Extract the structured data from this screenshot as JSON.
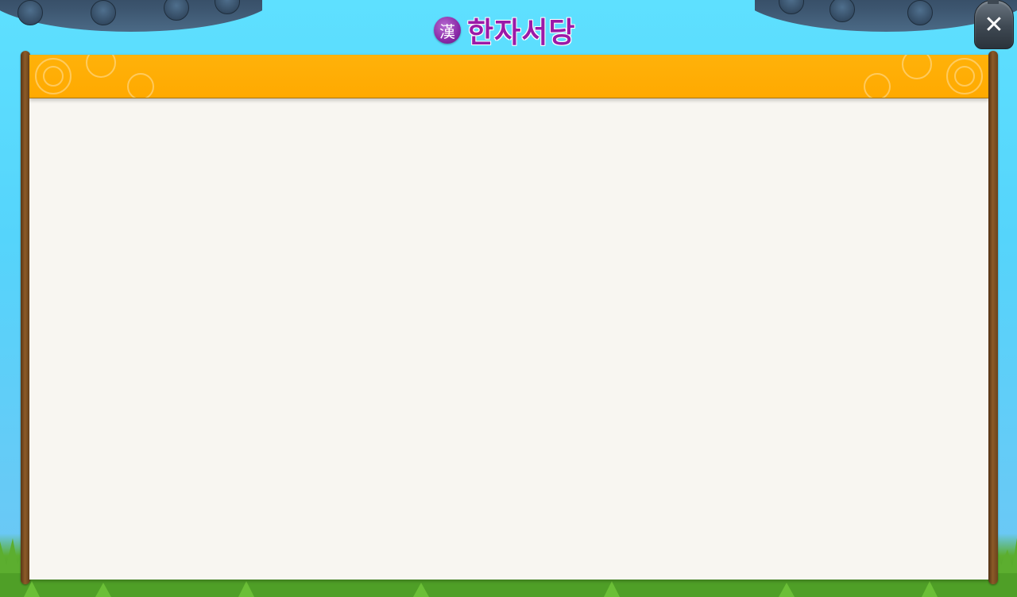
{
  "window": {
    "title": "한자서당",
    "badge_glyph": "漢",
    "close_label": "✕"
  },
  "panel": {
    "header_label": "",
    "body_text": ""
  },
  "colors": {
    "sky": "#5ee0ff",
    "title_text": "#9b1aa8",
    "badge": "#8a2aa8",
    "header_band": "#ffa900",
    "paper": "#f8f6f1",
    "pole": "#8c5a28",
    "grass": "#5cae2f",
    "roof": "#3d5670"
  },
  "icons": {
    "badge": "han-character-badge-icon",
    "close": "close-icon"
  }
}
